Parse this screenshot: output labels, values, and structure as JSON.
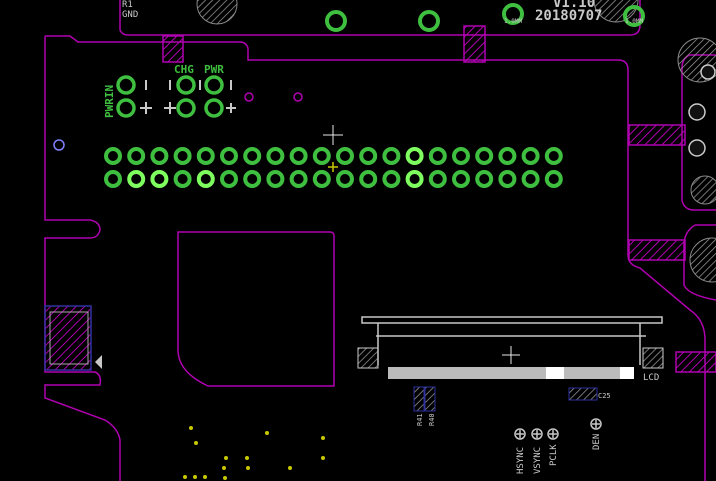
{
  "board": {
    "version_text": "V1.10",
    "date_text": "20180707",
    "gnd_label": "GND",
    "r1_label": "R1",
    "pin_sub_left": "1.0MM",
    "pin_sub_right": "1.0MM"
  },
  "labels": {
    "pwrin": "PWRIN",
    "chg": "CHG",
    "pwr": "PWR",
    "lcd": "LCD",
    "c25": "C25",
    "r41": "R41",
    "r40": "R40",
    "hsync": "HSYNC",
    "vsync": "VSYNC",
    "pclk": "PCLK",
    "den": "DEN"
  },
  "colors": {
    "background": "#000000",
    "board_outline": "#b000b0",
    "pad": "#3fbf3f",
    "pad_bright": "#7fff5f",
    "hatch": "#b000b0",
    "silkscreen": "#c8c8c8",
    "via": "#c8c800",
    "origin": "#e8e8e8"
  }
}
